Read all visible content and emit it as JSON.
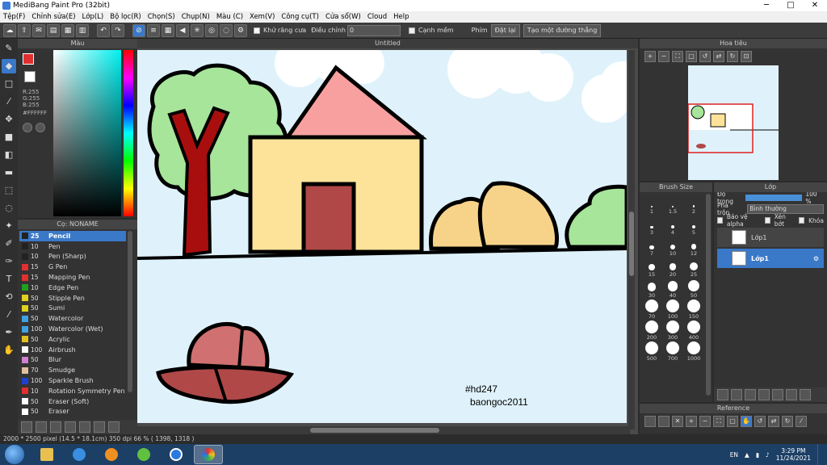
{
  "window": {
    "title": "MediBang Paint Pro (32bit)"
  },
  "menu": [
    "Tệp(F)",
    "Chỉnh sửa(E)",
    "Lớp(L)",
    "Bộ lọc(R)",
    "Chọn(S)",
    "Chụp(N)",
    "Màu (C)",
    "Xem(V)",
    "Công cụ(T)",
    "Cửa sổ(W)",
    "Cloud",
    "Help"
  ],
  "toolbar": {
    "antialias_label": "Khử răng cưa",
    "adjust_label": "Điều chỉnh",
    "adjust_value": "0",
    "soft_edge_label": "Cạnh mềm",
    "key_label": "Phím",
    "reset_label": "Đặt lại",
    "create_line_label": "Tạo một đường thẳng"
  },
  "color_panel": {
    "title": "Màu",
    "r": "R:255",
    "g": "G:255",
    "b": "B:255",
    "hex": "#FFFFFF"
  },
  "brush_panel": {
    "title": "Cọ: NONAME",
    "items": [
      {
        "size": "25",
        "name": "Pencil",
        "color": "#222222",
        "selected": true
      },
      {
        "size": "10",
        "name": "Pen",
        "color": "#222222"
      },
      {
        "size": "10",
        "name": "Pen (Sharp)",
        "color": "#222222"
      },
      {
        "size": "15",
        "name": "G Pen",
        "color": "#e03030"
      },
      {
        "size": "15",
        "name": "Mapping Pen",
        "color": "#e03030"
      },
      {
        "size": "10",
        "name": "Edge Pen",
        "color": "#20a020"
      },
      {
        "size": "50",
        "name": "Stipple Pen",
        "color": "#e0d020"
      },
      {
        "size": "50",
        "name": "Sumi",
        "color": "#e0d020"
      },
      {
        "size": "50",
        "name": "Watercolor",
        "color": "#40a0e0"
      },
      {
        "size": "100",
        "name": "Watercolor (Wet)",
        "color": "#40a0e0"
      },
      {
        "size": "50",
        "name": "Acrylic",
        "color": "#e0c020"
      },
      {
        "size": "100",
        "name": "Airbrush",
        "color": "#ffffff"
      },
      {
        "size": "50",
        "name": "Blur",
        "color": "#d080d0"
      },
      {
        "size": "70",
        "name": "Smudge",
        "color": "#e0c0a0"
      },
      {
        "size": "100",
        "name": "Sparkle Brush",
        "color": "#2040d0"
      },
      {
        "size": "10",
        "name": "Rotation Symmetry Pen",
        "color": "#e03030"
      },
      {
        "size": "50",
        "name": "Eraser (Soft)",
        "color": "#ffffff"
      },
      {
        "size": "50",
        "name": "Eraser",
        "color": "#ffffff"
      }
    ]
  },
  "canvas": {
    "title": "Untitled",
    "text_line1": "#hd247",
    "text_line2": "baongoc2011"
  },
  "navigator": {
    "title": "Hoa tiêu"
  },
  "brush_size": {
    "title": "Brush Size",
    "sizes": [
      "1",
      "1.5",
      "2",
      "3",
      "4",
      "5",
      "7",
      "10",
      "12",
      "15",
      "20",
      "25",
      "30",
      "40",
      "50",
      "70",
      "100",
      "150",
      "200",
      "300",
      "400",
      "500",
      "700",
      "1000"
    ]
  },
  "layer_panel": {
    "title": "Lớp",
    "opacity_label": "Độ trong",
    "opacity_value": "100 %",
    "blend_label": "Pha trộn",
    "blend_value": "Bình thường",
    "protect_alpha": "Bảo vệ alpha",
    "clip": "Xén bớt",
    "lock": "Khóa",
    "layers": [
      {
        "name": "Lớp1",
        "selected": false
      },
      {
        "name": "Lớp1",
        "selected": true
      }
    ]
  },
  "reference_panel": {
    "title": "Reference"
  },
  "status": {
    "text": "2000 * 2500 pixel   (14.5 * 18.1cm)   350 dpi   66 %   ( 1398, 1318 )"
  },
  "taskbar": {
    "lang": "EN",
    "time": "3:29 PM",
    "date": "11/24/2021"
  }
}
